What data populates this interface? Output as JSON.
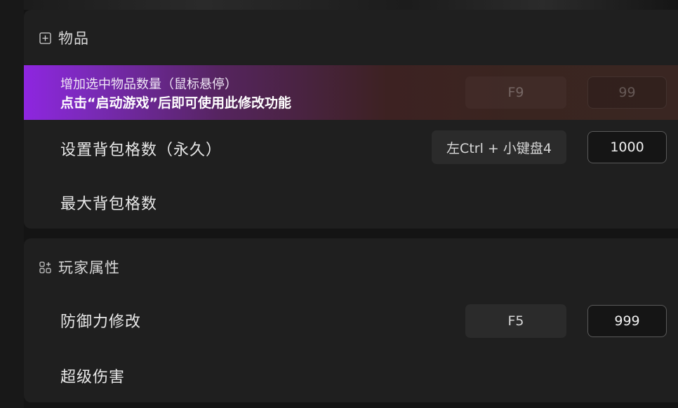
{
  "items_section": {
    "title": "物品",
    "icon": "plus-square-icon",
    "highlight": {
      "line1": "增加选中物品数量（鼠标悬停）",
      "line2": "点击“启动游戏”后即可使用此修改功能",
      "hotkey": "F9",
      "value": "99"
    },
    "rows": [
      {
        "label": "设置背包格数（永久）",
        "hotkey": "左Ctrl + 小键盘4",
        "value": "1000"
      },
      {
        "label": "最大背包格数"
      }
    ]
  },
  "player_section": {
    "title": "玩家属性",
    "icon": "apps-add-icon",
    "rows": [
      {
        "label": "防御力修改",
        "hotkey": "F5",
        "value": "999"
      },
      {
        "label": "超级伤害"
      }
    ]
  },
  "colors": {
    "highlight_start": "#8e26e0",
    "panel_bg": "#1f1f1f"
  }
}
